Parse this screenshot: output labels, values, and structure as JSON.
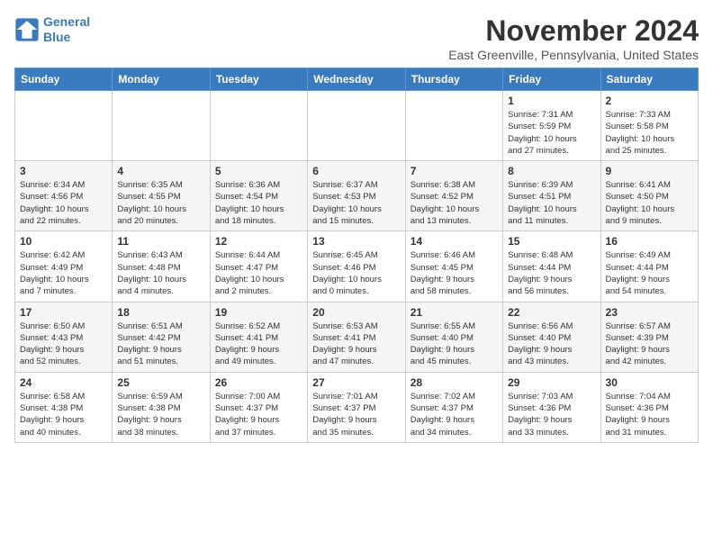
{
  "header": {
    "logo_line1": "General",
    "logo_line2": "Blue",
    "month": "November 2024",
    "location": "East Greenville, Pennsylvania, United States"
  },
  "weekdays": [
    "Sunday",
    "Monday",
    "Tuesday",
    "Wednesday",
    "Thursday",
    "Friday",
    "Saturday"
  ],
  "weeks": [
    [
      {
        "day": "",
        "info": ""
      },
      {
        "day": "",
        "info": ""
      },
      {
        "day": "",
        "info": ""
      },
      {
        "day": "",
        "info": ""
      },
      {
        "day": "",
        "info": ""
      },
      {
        "day": "1",
        "info": "Sunrise: 7:31 AM\nSunset: 5:59 PM\nDaylight: 10 hours\nand 27 minutes."
      },
      {
        "day": "2",
        "info": "Sunrise: 7:33 AM\nSunset: 5:58 PM\nDaylight: 10 hours\nand 25 minutes."
      }
    ],
    [
      {
        "day": "3",
        "info": "Sunrise: 6:34 AM\nSunset: 4:56 PM\nDaylight: 10 hours\nand 22 minutes."
      },
      {
        "day": "4",
        "info": "Sunrise: 6:35 AM\nSunset: 4:55 PM\nDaylight: 10 hours\nand 20 minutes."
      },
      {
        "day": "5",
        "info": "Sunrise: 6:36 AM\nSunset: 4:54 PM\nDaylight: 10 hours\nand 18 minutes."
      },
      {
        "day": "6",
        "info": "Sunrise: 6:37 AM\nSunset: 4:53 PM\nDaylight: 10 hours\nand 15 minutes."
      },
      {
        "day": "7",
        "info": "Sunrise: 6:38 AM\nSunset: 4:52 PM\nDaylight: 10 hours\nand 13 minutes."
      },
      {
        "day": "8",
        "info": "Sunrise: 6:39 AM\nSunset: 4:51 PM\nDaylight: 10 hours\nand 11 minutes."
      },
      {
        "day": "9",
        "info": "Sunrise: 6:41 AM\nSunset: 4:50 PM\nDaylight: 10 hours\nand 9 minutes."
      }
    ],
    [
      {
        "day": "10",
        "info": "Sunrise: 6:42 AM\nSunset: 4:49 PM\nDaylight: 10 hours\nand 7 minutes."
      },
      {
        "day": "11",
        "info": "Sunrise: 6:43 AM\nSunset: 4:48 PM\nDaylight: 10 hours\nand 4 minutes."
      },
      {
        "day": "12",
        "info": "Sunrise: 6:44 AM\nSunset: 4:47 PM\nDaylight: 10 hours\nand 2 minutes."
      },
      {
        "day": "13",
        "info": "Sunrise: 6:45 AM\nSunset: 4:46 PM\nDaylight: 10 hours\nand 0 minutes."
      },
      {
        "day": "14",
        "info": "Sunrise: 6:46 AM\nSunset: 4:45 PM\nDaylight: 9 hours\nand 58 minutes."
      },
      {
        "day": "15",
        "info": "Sunrise: 6:48 AM\nSunset: 4:44 PM\nDaylight: 9 hours\nand 56 minutes."
      },
      {
        "day": "16",
        "info": "Sunrise: 6:49 AM\nSunset: 4:44 PM\nDaylight: 9 hours\nand 54 minutes."
      }
    ],
    [
      {
        "day": "17",
        "info": "Sunrise: 6:50 AM\nSunset: 4:43 PM\nDaylight: 9 hours\nand 52 minutes."
      },
      {
        "day": "18",
        "info": "Sunrise: 6:51 AM\nSunset: 4:42 PM\nDaylight: 9 hours\nand 51 minutes."
      },
      {
        "day": "19",
        "info": "Sunrise: 6:52 AM\nSunset: 4:41 PM\nDaylight: 9 hours\nand 49 minutes."
      },
      {
        "day": "20",
        "info": "Sunrise: 6:53 AM\nSunset: 4:41 PM\nDaylight: 9 hours\nand 47 minutes."
      },
      {
        "day": "21",
        "info": "Sunrise: 6:55 AM\nSunset: 4:40 PM\nDaylight: 9 hours\nand 45 minutes."
      },
      {
        "day": "22",
        "info": "Sunrise: 6:56 AM\nSunset: 4:40 PM\nDaylight: 9 hours\nand 43 minutes."
      },
      {
        "day": "23",
        "info": "Sunrise: 6:57 AM\nSunset: 4:39 PM\nDaylight: 9 hours\nand 42 minutes."
      }
    ],
    [
      {
        "day": "24",
        "info": "Sunrise: 6:58 AM\nSunset: 4:38 PM\nDaylight: 9 hours\nand 40 minutes."
      },
      {
        "day": "25",
        "info": "Sunrise: 6:59 AM\nSunset: 4:38 PM\nDaylight: 9 hours\nand 38 minutes."
      },
      {
        "day": "26",
        "info": "Sunrise: 7:00 AM\nSunset: 4:37 PM\nDaylight: 9 hours\nand 37 minutes."
      },
      {
        "day": "27",
        "info": "Sunrise: 7:01 AM\nSunset: 4:37 PM\nDaylight: 9 hours\nand 35 minutes."
      },
      {
        "day": "28",
        "info": "Sunrise: 7:02 AM\nSunset: 4:37 PM\nDaylight: 9 hours\nand 34 minutes."
      },
      {
        "day": "29",
        "info": "Sunrise: 7:03 AM\nSunset: 4:36 PM\nDaylight: 9 hours\nand 33 minutes."
      },
      {
        "day": "30",
        "info": "Sunrise: 7:04 AM\nSunset: 4:36 PM\nDaylight: 9 hours\nand 31 minutes."
      }
    ]
  ]
}
